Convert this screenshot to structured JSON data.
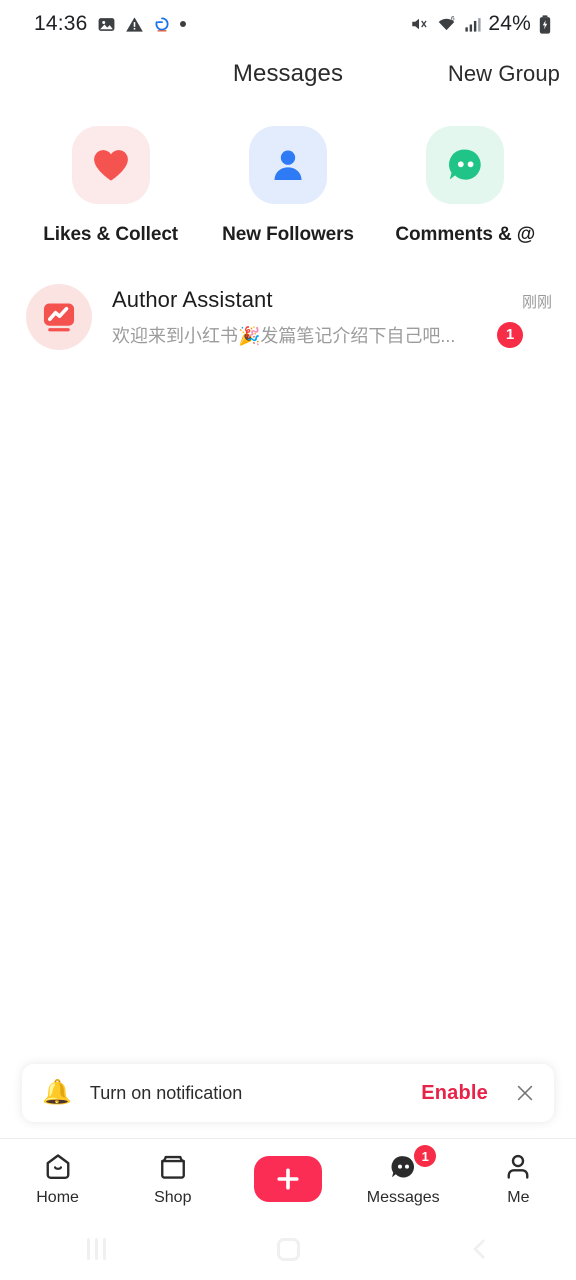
{
  "status_bar": {
    "time": "14:36",
    "left_icons": [
      "image-icon",
      "warning-icon",
      "sync-icon",
      "dot-icon"
    ],
    "right_icons": [
      "mute-icon",
      "wifi-icon",
      "signal-icon",
      "battery-charging-icon"
    ],
    "battery_percent": "24%"
  },
  "header": {
    "title": "Messages",
    "action_label": "New Group"
  },
  "categories": [
    {
      "label": "Likes & Collect",
      "icon": "heart-icon",
      "bg": "#fce9e9",
      "fg": "#f5534f"
    },
    {
      "label": "New Followers",
      "icon": "person-icon",
      "bg": "#e2ecfd",
      "fg": "#2f7bf6"
    },
    {
      "label": "Comments & @",
      "icon": "chat-icon",
      "bg": "#e3f7ee",
      "fg": "#21c487"
    }
  ],
  "conversations": [
    {
      "name": "Author Assistant",
      "preview": "欢迎来到小红书🎉发篇笔记介绍下自己吧...",
      "time": "刚刚",
      "badge": "1",
      "avatar_icon": "chart-monitor-icon"
    }
  ],
  "notification_banner": {
    "icon": "bell-icon",
    "text": "Turn on notification",
    "cta_label": "Enable",
    "close_icon": "close-icon"
  },
  "tabbar": {
    "items": [
      {
        "label": "Home",
        "icon": "home-icon"
      },
      {
        "label": "Shop",
        "icon": "shop-icon"
      },
      {
        "label": "",
        "icon": "plus-icon"
      },
      {
        "label": "Messages",
        "icon": "messages-bubble-icon",
        "badge": "1"
      },
      {
        "label": "Me",
        "icon": "person-outline-icon"
      }
    ]
  },
  "system_nav": {
    "recents_icon": "recents-icon",
    "home_icon": "home-square-icon",
    "back_icon": "back-chevron-icon"
  },
  "colors": {
    "accent_red": "#fc2d55",
    "badge_red": "#f72c47",
    "cta_red": "#e8234a"
  }
}
